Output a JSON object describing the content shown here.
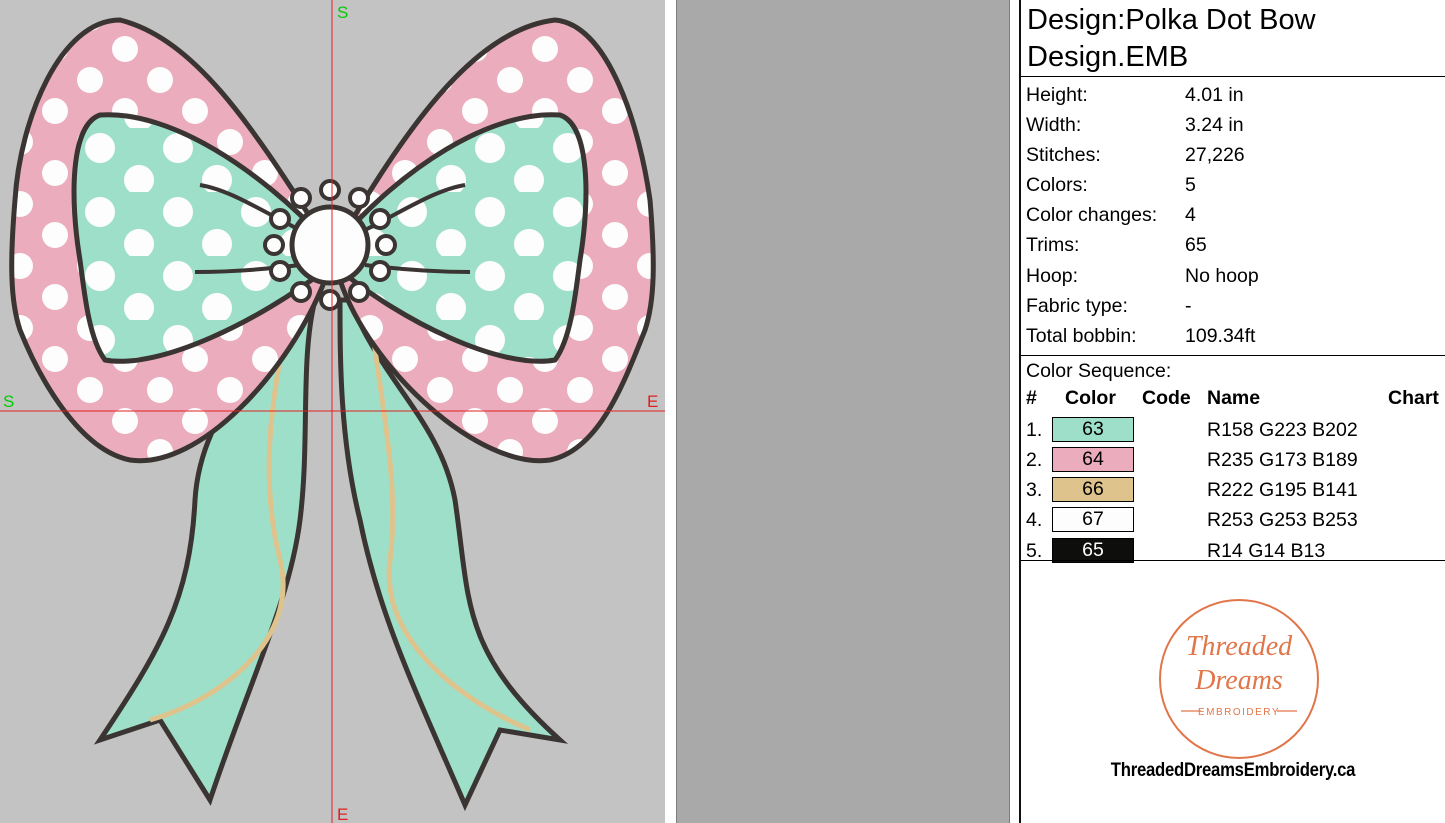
{
  "canvas": {
    "axis_labels": {
      "top": "S",
      "left": "S",
      "right": "E",
      "bottom": "E"
    },
    "design_colors": {
      "mint": "#9edfca",
      "pink": "#ebadbd",
      "gold": "#dec38d",
      "white": "#fdfdfd",
      "outline": "#0e0e0d"
    }
  },
  "title": {
    "line1": "Design:Polka Dot Bow",
    "line2": "Design.EMB"
  },
  "info": [
    {
      "key": "Height:",
      "value": "4.01 in"
    },
    {
      "key": "Width:",
      "value": "3.24 in"
    },
    {
      "key": "Stitches:",
      "value": "27,226"
    },
    {
      "key": "Colors:",
      "value": "5"
    },
    {
      "key": "Color changes:",
      "value": "4"
    },
    {
      "key": "Trims:",
      "value": "65"
    },
    {
      "key": "Hoop:",
      "value": "No hoop"
    },
    {
      "key": "Fabric type:",
      "value": "-"
    },
    {
      "key": "Total bobbin:",
      "value": "109.34ft"
    }
  ],
  "sequence": {
    "label": "Color Sequence:",
    "headers": {
      "num": "#",
      "color": "Color",
      "code": "Code",
      "name": "Name",
      "chart": "Chart"
    },
    "rows": [
      {
        "num": "1.",
        "code": "63",
        "name": "R158 G223 B202",
        "hex": "#9edfca",
        "text": "#000000"
      },
      {
        "num": "2.",
        "code": "64",
        "name": "R235 G173 B189",
        "hex": "#ebadbd",
        "text": "#000000"
      },
      {
        "num": "3.",
        "code": "66",
        "name": "R222 G195 B141",
        "hex": "#dec38d",
        "text": "#000000"
      },
      {
        "num": "4.",
        "code": "67",
        "name": "R253 G253 B253",
        "hex": "#fdfdfd",
        "text": "#000000"
      },
      {
        "num": "5.",
        "code": "65",
        "name": "R14 G14 B13",
        "hex": "#0e0e0d",
        "text": "#ffffff"
      }
    ]
  },
  "logo": {
    "line1": "Threaded",
    "line2": "Dreams",
    "line3": "EMBROIDERY",
    "accent": "#e0764a"
  },
  "website": "ThreadedDreamsEmbroidery.ca"
}
